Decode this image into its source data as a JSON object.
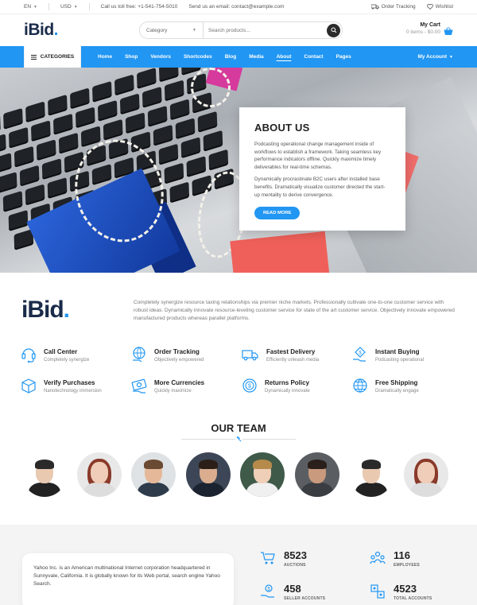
{
  "topbar": {
    "language": "EN",
    "currency": "USD",
    "phone": "Call us toll free: +1-541-754-5010",
    "email": "Send us an email: contact@example.com",
    "order_tracking": "Order Tracking",
    "wishlist": "Wishlist"
  },
  "header": {
    "logo_text": "iBid",
    "logo_dot": ".",
    "search_category": "Category",
    "search_placeholder": "Search products...",
    "cart_title": "My Cart",
    "cart_summary": "0 items - $0.00"
  },
  "nav": {
    "categories": "CATEGORIES",
    "links": [
      "Home",
      "Shop",
      "Vendors",
      "Shortcodes",
      "Blog",
      "Media",
      "About",
      "Contact",
      "Pages"
    ],
    "my_account": "My Account"
  },
  "hero": {
    "title": "ABOUT US",
    "para1": "Podcasting operational change management inside of workflows to establish a framework. Taking seamless key performance indicators offline. Quickly maximize timely deliverables for real-time schemas.",
    "para2": "Dynamically procrastinate B2C users after installed base benefits. Dramatically visualize customer directed the start-up mentality to derive convergence.",
    "button": "READ MORE"
  },
  "intro": {
    "logo_text": "iBid",
    "logo_dot": ".",
    "text": "Completely synergize resource taxing relationships via premier niche markets. Professionally cultivate one-to-one customer service with robust ideas. Dynamically innovate resource-leveling customer service for state of the art customer service. Objectively innovate empowered manufactured products whereas parallel platforms."
  },
  "features": [
    {
      "title": "Call Center",
      "sub": "Completely synergize",
      "icon": "headset-icon"
    },
    {
      "title": "Order Tracking",
      "sub": "Objectively empowered",
      "icon": "globe-hand-icon"
    },
    {
      "title": "Fastest Delivery",
      "sub": "Efficiently unleash media",
      "icon": "truck-icon"
    },
    {
      "title": "Instant Buying",
      "sub": "Podcasting operational",
      "icon": "hand-coin-icon"
    },
    {
      "title": "Verify Purchases",
      "sub": "Nanotechnology immersion",
      "icon": "box-icon"
    },
    {
      "title": "More Currencies",
      "sub": "Quickly maximize",
      "icon": "cash-icon"
    },
    {
      "title": "Returns Policy",
      "sub": "Dynamically innovate",
      "icon": "coin-return-icon"
    },
    {
      "title": "Free Shipping",
      "sub": "Dramatically engage",
      "icon": "globe-icon"
    }
  ],
  "team": {
    "title": "OUR TEAM"
  },
  "bottom": {
    "quote": "Yahoo Inc. is an American multinational Internet corporation headquartered in Sunnyvale, California. It is globally known for its Web portal, search engine Yahoo Search.",
    "stats": [
      {
        "num": "8523",
        "label": "AUCTIONS",
        "icon": "cart-icon"
      },
      {
        "num": "116",
        "label": "EMPLOYEES",
        "icon": "people-icon"
      },
      {
        "num": "458",
        "label": "SELLER ACCOUNTS",
        "icon": "hand-coin-icon"
      },
      {
        "num": "4523",
        "label": "TOTAL ACCOUNTS",
        "icon": "accounts-icon"
      }
    ]
  },
  "colors": {
    "accent": "#2196f3",
    "dark": "#1a2b4a",
    "nav_text": "#ffffff"
  }
}
